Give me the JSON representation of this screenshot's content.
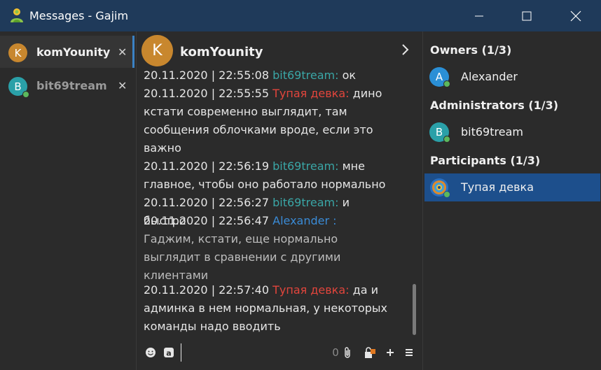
{
  "window": {
    "title": "Messages - Gajim"
  },
  "tabs": [
    {
      "initial": "K",
      "label": "komYounity",
      "avatar_color": "#c8872e",
      "active": true
    },
    {
      "initial": "B",
      "label": "bit69tream",
      "avatar_color": "#2aa0a8",
      "active": false
    }
  ],
  "chat": {
    "title": "komYounity",
    "initial": "K"
  },
  "messages": [
    {
      "timestamp": "20.11.2020 | 22:55:08",
      "nick": "bit69tream:",
      "text": "ок"
    },
    {
      "timestamp": "20.11.2020 | 22:55:55",
      "nick": "Тупая девка:",
      "text": "дино кстати современно выглядит, там сообщения облочками вроде, если это важно"
    },
    {
      "timestamp": "20.11.2020 | 22:56:19",
      "nick": "bit69tream:",
      "text": "мне главное, чтобы оно работало нормально"
    },
    {
      "timestamp": "20.11.2020 | 22:56:27",
      "nick": "bit69tream:",
      "text": "и быстро"
    },
    {
      "timestamp": "20.11.2020 | 22:56:47",
      "nick": "Alexander :",
      "text": "Гаджим, кстати, еще нормально выглядит в сравнении с другими клиентами"
    },
    {
      "timestamp": "20.11.2020 | 22:57:40",
      "nick": "Тупая девка:",
      "text": "да и админка в нем нормальная, у некоторых команды надо вводить"
    }
  ],
  "input": {
    "counter": "0"
  },
  "roster": {
    "groups": [
      {
        "title": "Owners (1/3)",
        "members": [
          {
            "initial": "A",
            "name": "Alexander",
            "avatar_color": "#2a8fd6"
          }
        ]
      },
      {
        "title": "Administrators (1/3)",
        "members": [
          {
            "initial": "B",
            "name": "bit69tream",
            "avatar_color": "#2aa0a8"
          }
        ]
      },
      {
        "title": "Participants (1/3)",
        "members": [
          {
            "initial": "",
            "name": "Тупая девка",
            "avatar_color": "#e08a2a",
            "selected": true
          }
        ]
      }
    ]
  },
  "colors": {
    "accent": "#1d4f8c",
    "titlebar": "#1f3a5a",
    "online": "#5cb85c"
  }
}
